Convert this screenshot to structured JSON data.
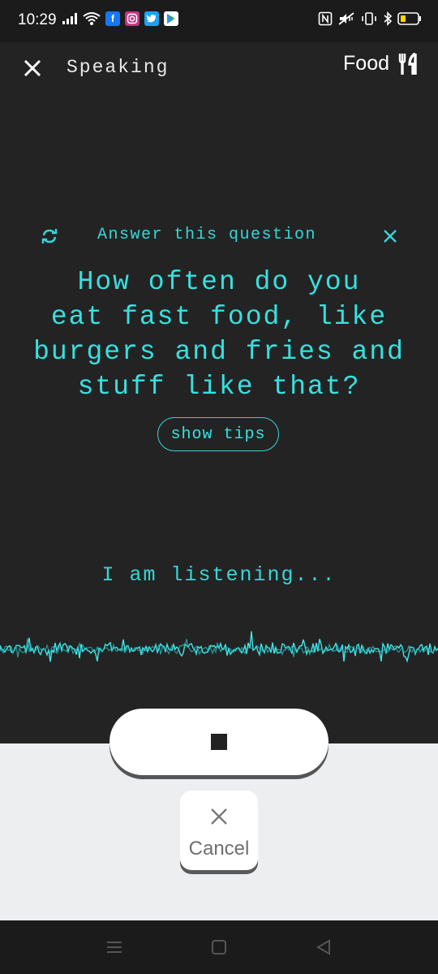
{
  "status_bar": {
    "time": "10:29",
    "left_icons": [
      "signal-icon",
      "wifi-icon",
      "facebook-icon",
      "instagram-icon",
      "twitter-icon",
      "play-store-icon"
    ],
    "right_icons": [
      "nfc-icon",
      "mute-vibrate-icon",
      "vibrate-icon",
      "bluetooth-icon",
      "battery-icon"
    ],
    "battery_color": "#ffd400"
  },
  "header": {
    "mode_label": "Speaking",
    "topic": "Food",
    "topic_icon": "fork-knife-icon"
  },
  "question_card": {
    "prompt_label": "Answer this question",
    "question_lines": [
      "How often do you",
      "eat fast food, like",
      "burgers and fries and",
      "stuff like that?"
    ],
    "tips_label": "show tips"
  },
  "listening_label": "I am listening...",
  "controls": {
    "stop_icon": "stop-icon",
    "cancel_label": "Cancel",
    "cancel_icon": "close-icon"
  },
  "nav_bar": {
    "icons": [
      "menu-icon",
      "home-icon",
      "back-icon"
    ]
  },
  "colors": {
    "accent": "#37e0e0",
    "background": "#232323",
    "panel": "#eceef0"
  }
}
